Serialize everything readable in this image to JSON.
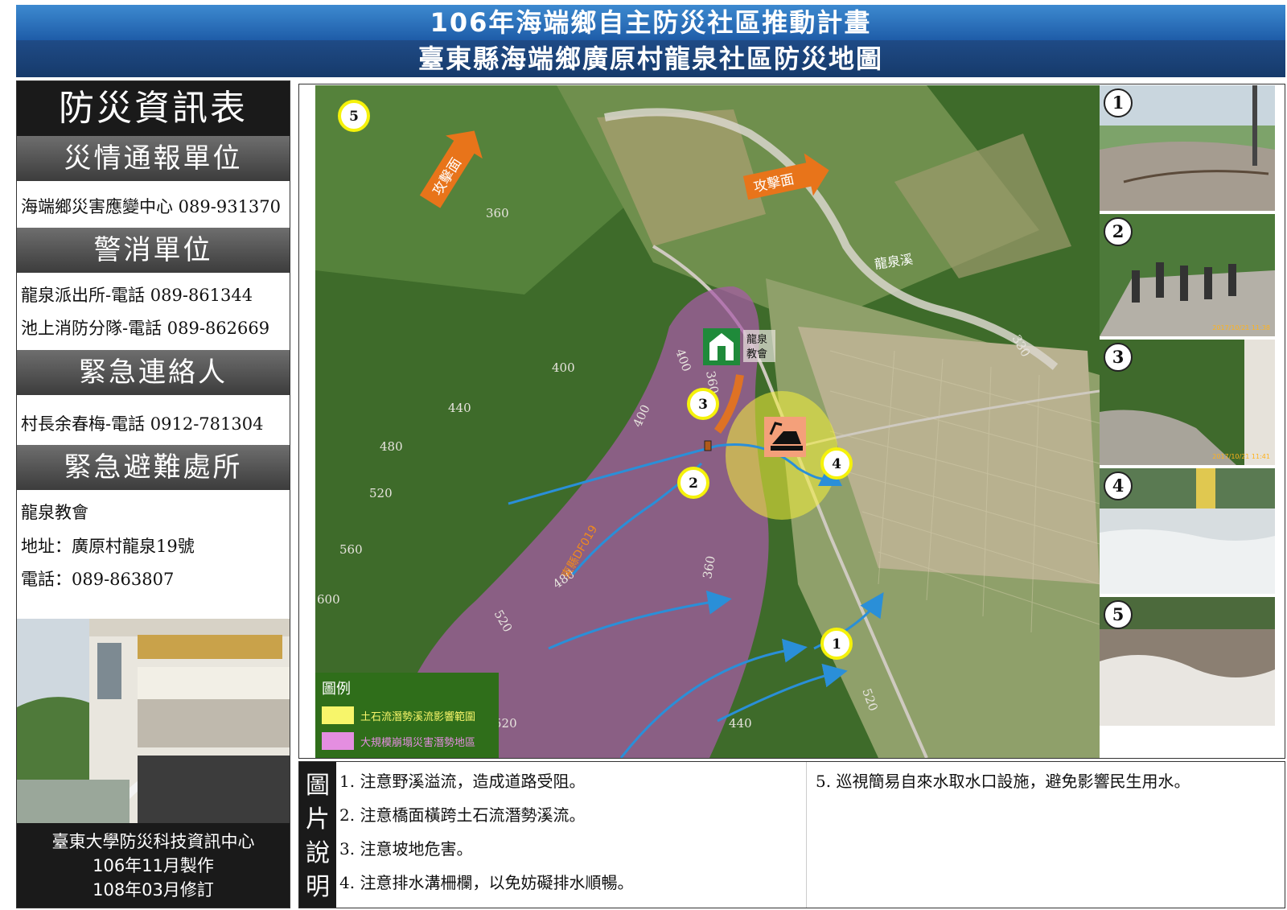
{
  "header": {
    "title": "106年海端鄉自主防災社區推動計畫",
    "subtitle": "臺東縣海端鄉廣原村龍泉社區防災地圖"
  },
  "info_panel": {
    "title": "防災資訊表",
    "sections": [
      {
        "heading": "災情通報單位",
        "lines": [
          "海端鄉災害應變中心 089-931370"
        ]
      },
      {
        "heading": "警消單位",
        "lines": [
          "龍泉派出所-電話  089-861344",
          "池上消防分隊-電話  089-862669"
        ]
      },
      {
        "heading": "緊急連絡人",
        "lines": [
          "村長余春梅-電話  0912-781304"
        ]
      },
      {
        "heading": "緊急避難處所",
        "lines": [
          "龍泉教會",
          "地址：廣原村龍泉19號",
          "電話：089-863807"
        ]
      }
    ],
    "footer": [
      "臺東大學防災科技資訊中心",
      "106年11月製作",
      "108年03月修訂"
    ]
  },
  "map": {
    "attack_face_labels": [
      "攻擊面",
      "攻擊面"
    ],
    "river_label": "龍泉溪",
    "shelter_label": [
      "龍泉",
      "教會"
    ],
    "stream_label": "東縣DF019",
    "contours": [
      "360",
      "400",
      "440",
      "480",
      "520",
      "560",
      "600",
      "400",
      "360",
      "400",
      "480",
      "520",
      "360",
      "440",
      "520",
      "330",
      "520"
    ],
    "markers": [
      "1",
      "2",
      "3",
      "4",
      "5"
    ],
    "colors": {
      "landslide_zone": "#a85aa8",
      "debris_flow_zone": "#f5f03a",
      "flow_arrow": "#2a8fd8",
      "attack_arrow": "#e8741a",
      "marker_ring": "#f5f20a"
    }
  },
  "legend": {
    "title": "圖例",
    "items": [
      {
        "label": "土石流潛勢溪流影響範圍",
        "color": "#f7f56a"
      },
      {
        "label": "大規模崩塌災害潛勢地區",
        "color": "#e48ee0"
      }
    ]
  },
  "photos": [
    {
      "number": "1",
      "stamp": ""
    },
    {
      "number": "2",
      "stamp": "2017/10/21 11:38"
    },
    {
      "number": "3",
      "stamp": "2017/10/21 11:41"
    },
    {
      "number": "4",
      "stamp": ""
    },
    {
      "number": "5",
      "stamp": ""
    }
  ],
  "notes": {
    "side_label": [
      "圖",
      "片",
      "說",
      "明"
    ],
    "items": [
      "1. 注意野溪溢流，造成道路受阻。",
      "2. 注意橋面橫跨土石流潛勢溪流。",
      "3. 注意坡地危害。",
      "4. 注意排水溝柵欄，以免妨礙排水順暢。",
      "5. 巡視簡易自來水取水口設施，避免影響民生用水。"
    ]
  }
}
